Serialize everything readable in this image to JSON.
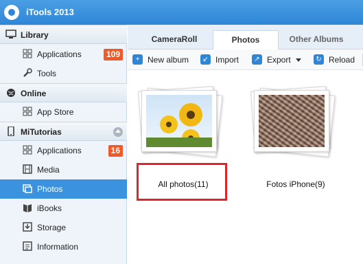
{
  "app": {
    "title": "iTools 2013"
  },
  "sidebar": {
    "sections": [
      {
        "label": "Library",
        "icon": "monitor-icon"
      },
      {
        "label": "Online",
        "icon": "globe-icon"
      },
      {
        "label": "MiTutorias",
        "icon": "phone-icon"
      }
    ],
    "items": [
      {
        "label": "Applications",
        "badge": "109",
        "icon": "grid-icon"
      },
      {
        "label": "Tools",
        "icon": "wrench-icon"
      },
      {
        "label": "App Store",
        "icon": "grid-icon"
      },
      {
        "label": "Applications",
        "badge": "16",
        "icon": "grid-icon"
      },
      {
        "label": "Media",
        "icon": "film-icon"
      },
      {
        "label": "Photos",
        "icon": "photo-icon",
        "active": true
      },
      {
        "label": "iBooks",
        "icon": "book-icon"
      },
      {
        "label": "Storage",
        "icon": "storage-icon"
      },
      {
        "label": "Information",
        "icon": "info-icon"
      }
    ]
  },
  "tabs": [
    {
      "label": "CameraRoll"
    },
    {
      "label": "Photos",
      "active": true
    },
    {
      "label": "Other Albums"
    }
  ],
  "toolbar": {
    "new_album": "New album",
    "import": "Import",
    "export": "Export",
    "reload": "Reload"
  },
  "albums": [
    {
      "label": "All photos(11)",
      "selected": true
    },
    {
      "label": "Fotos iPhone(9)"
    }
  ],
  "colors": {
    "accent": "#2f86d6",
    "badge": "#ef5a2a",
    "highlight": "#e0242a",
    "active_item": "#3b93df"
  }
}
